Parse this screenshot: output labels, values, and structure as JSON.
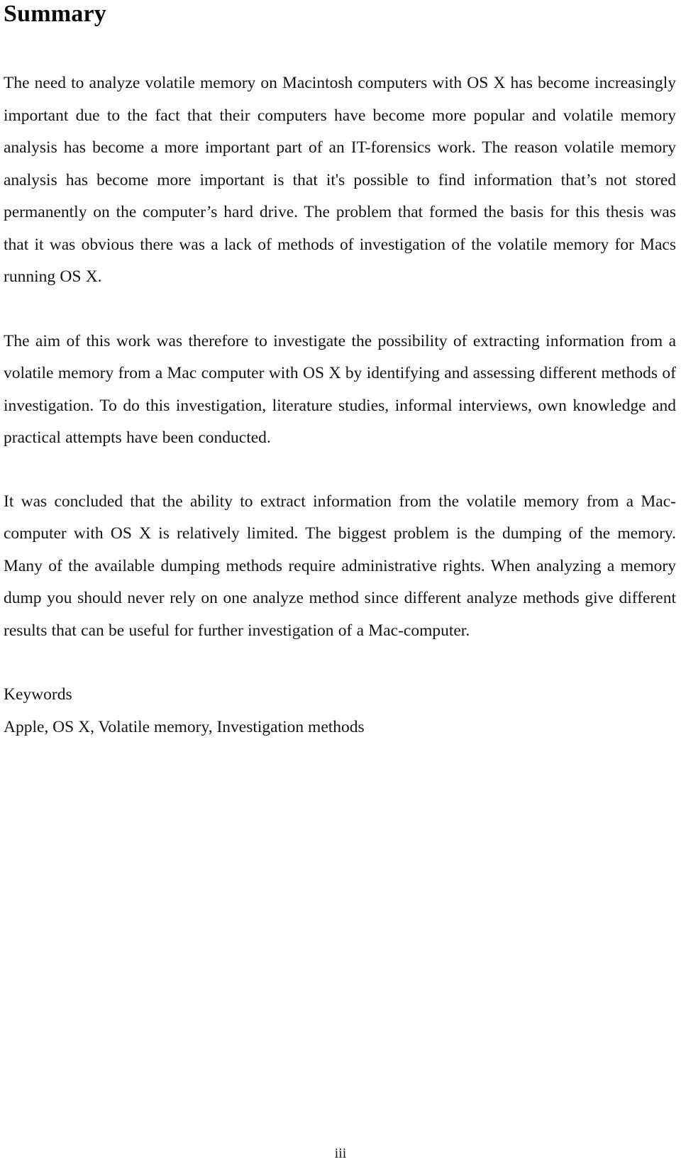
{
  "document": {
    "title": "Summary",
    "paragraphs": [
      "The need to analyze volatile memory on Macintosh computers with OS X has become increasingly important due to the fact that their computers have become more popular and volatile memory analysis has become a more important part of an IT-forensics work. The reason volatile memory analysis has become more important is that it's possible to find information that’s not stored permanently on the computer’s hard drive. The problem that formed the basis for this thesis was that it was obvious there was a lack of methods of investigation of the volatile memory for Macs running OS X.",
      "The aim of this work was therefore to investigate the possibility of extracting information from a volatile memory from a Mac computer with OS X by identifying and assessing different methods of investigation. To do this investigation, literature studies, informal interviews, own knowledge and practical attempts have been conducted.",
      "It was concluded that the ability to extract information from the volatile memory from a Mac-computer with OS X is relatively limited. The biggest problem is the dumping of the memory. Many of the available dumping methods require administrative rights. When analyzing a memory dump you should never rely on one analyze method since different analyze methods give different results that can be useful for further investigation of a Mac-computer."
    ],
    "keywords_heading": "Keywords",
    "keywords": "Apple, OS X, Volatile memory, Investigation methods",
    "page_number": "iii"
  }
}
